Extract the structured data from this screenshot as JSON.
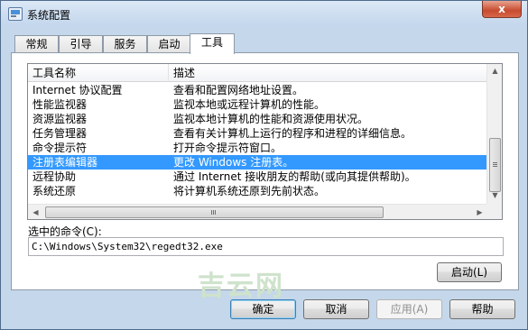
{
  "window": {
    "title": "系统配置",
    "close_label": "x"
  },
  "tabs": [
    {
      "label": "常规"
    },
    {
      "label": "引导"
    },
    {
      "label": "服务"
    },
    {
      "label": "启动"
    },
    {
      "label": "工具",
      "active": true
    }
  ],
  "tools_list": {
    "columns": [
      "工具名称",
      "描述"
    ],
    "rows": [
      {
        "name": "Internet 协议配置",
        "desc": "查看和配置网络地址设置。"
      },
      {
        "name": "性能监视器",
        "desc": "监视本地或远程计算机的性能。"
      },
      {
        "name": "资源监视器",
        "desc": "监视本地计算机的性能和资源使用状况。"
      },
      {
        "name": "任务管理器",
        "desc": "查看有关计算机上运行的程序和进程的详细信息。"
      },
      {
        "name": "命令提示符",
        "desc": "打开命令提示符窗口。"
      },
      {
        "name": "注册表编辑器",
        "desc": "更改 Windows 注册表。",
        "selected": true
      },
      {
        "name": "远程协助",
        "desc": "通过 Internet 接收朋友的帮助(或向其提供帮助)。"
      },
      {
        "name": "系统还原",
        "desc": "将计算机系统还原到先前状态。"
      }
    ]
  },
  "command": {
    "label": "选中的命令(C):",
    "value": "C:\\Windows\\System32\\regedt32.exe"
  },
  "buttons": {
    "launch": "启动(L)",
    "ok": "确定",
    "cancel": "取消",
    "apply": "应用(A)",
    "help": "帮助"
  },
  "watermark": "吉云网"
}
